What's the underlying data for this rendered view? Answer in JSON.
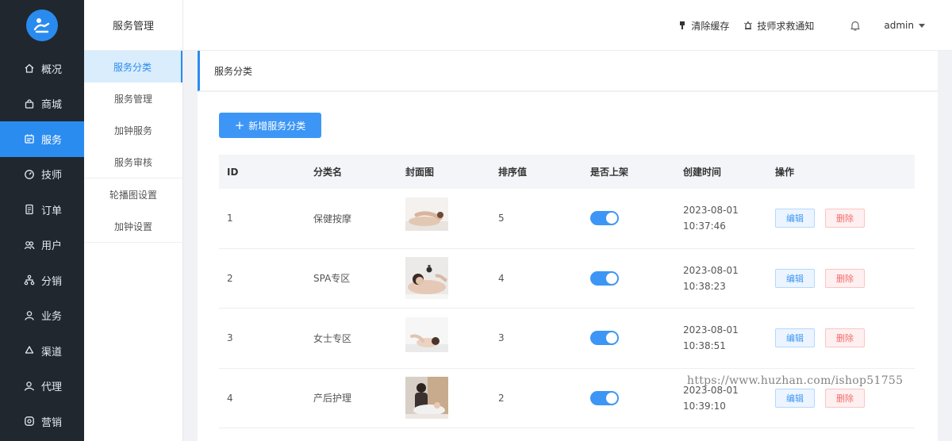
{
  "sidebar": {
    "items": [
      {
        "label": "概况",
        "icon": "home-icon"
      },
      {
        "label": "商城",
        "icon": "bag-icon"
      },
      {
        "label": "服务",
        "icon": "service-icon",
        "active": true
      },
      {
        "label": "技师",
        "icon": "gauge-icon"
      },
      {
        "label": "订单",
        "icon": "document-icon"
      },
      {
        "label": "用户",
        "icon": "users-icon"
      },
      {
        "label": "分销",
        "icon": "network-icon"
      },
      {
        "label": "业务",
        "icon": "person-icon"
      },
      {
        "label": "渠道",
        "icon": "recycle-icon"
      },
      {
        "label": "代理",
        "icon": "agent-icon"
      },
      {
        "label": "营销",
        "icon": "marketing-icon"
      }
    ]
  },
  "submenu": {
    "title": "服务管理",
    "items": [
      "服务分类",
      "服务管理",
      "加钟服务",
      "服务审核"
    ],
    "items2": [
      "轮播图设置",
      "加钟设置"
    ]
  },
  "header": {
    "clear_cache": "清除缓存",
    "rescue_notice": "技师求救通知",
    "user": "admin"
  },
  "breadcrumb": "服务分类",
  "add_button": "新增服务分类",
  "table": {
    "columns": [
      "ID",
      "分类名",
      "封面图",
      "排序值",
      "是否上架",
      "创建时间",
      "操作"
    ],
    "edit_label": "编辑",
    "delete_label": "删除",
    "rows": [
      {
        "id": "1",
        "name": "保健按摩",
        "sort": "5",
        "date": "2023-08-01",
        "time": "10:37:46"
      },
      {
        "id": "2",
        "name": "SPA专区",
        "sort": "4",
        "date": "2023-08-01",
        "time": "10:38:23"
      },
      {
        "id": "3",
        "name": "女士专区",
        "sort": "3",
        "date": "2023-08-01",
        "time": "10:38:51"
      },
      {
        "id": "4",
        "name": "产后护理",
        "sort": "2",
        "date": "2023-08-01",
        "time": "10:39:10"
      }
    ]
  },
  "watermark": "https://www.huzhan.com/ishop51755",
  "colors": {
    "accent": "#2b8cf0",
    "sidebar_bg": "#20272f",
    "danger": "#f56c6c"
  }
}
